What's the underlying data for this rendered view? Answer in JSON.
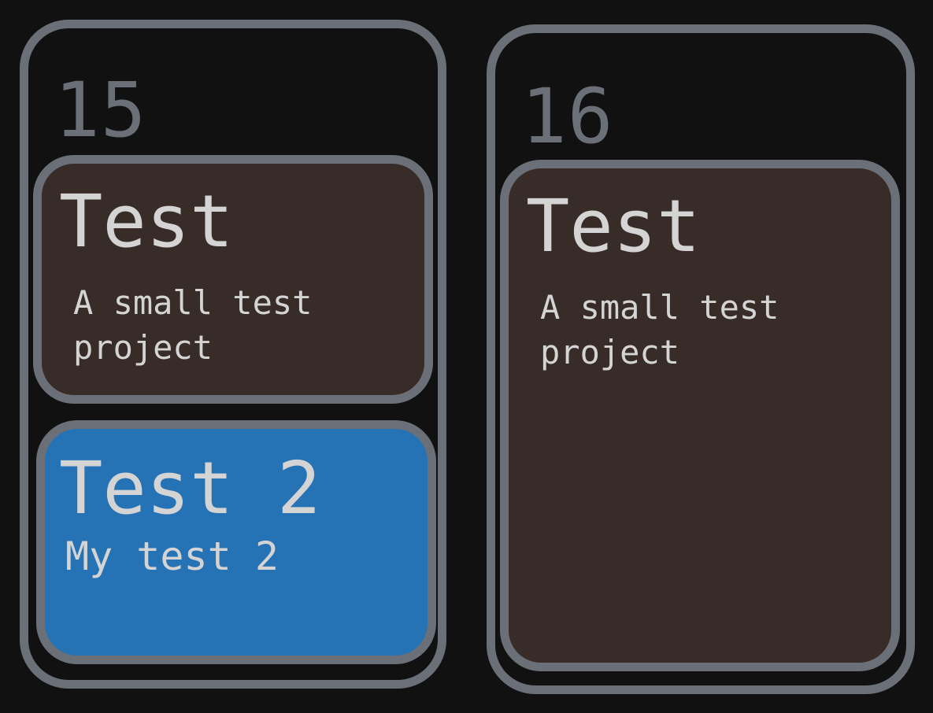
{
  "columns": [
    {
      "day": "15",
      "cards": [
        {
          "title": "Test",
          "description": "A small test project",
          "color": "#382c28"
        },
        {
          "title": "Test 2",
          "description": "My test 2",
          "color": "#2572b4"
        }
      ]
    },
    {
      "day": "16",
      "cards": [
        {
          "title": "Test",
          "description": "A small test project",
          "color": "#382c28"
        }
      ]
    }
  ],
  "colors": {
    "background": "#111111",
    "border": "#6b7078",
    "card_brown": "#382c28",
    "card_blue": "#2572b4",
    "text": "#d4d4d4"
  }
}
